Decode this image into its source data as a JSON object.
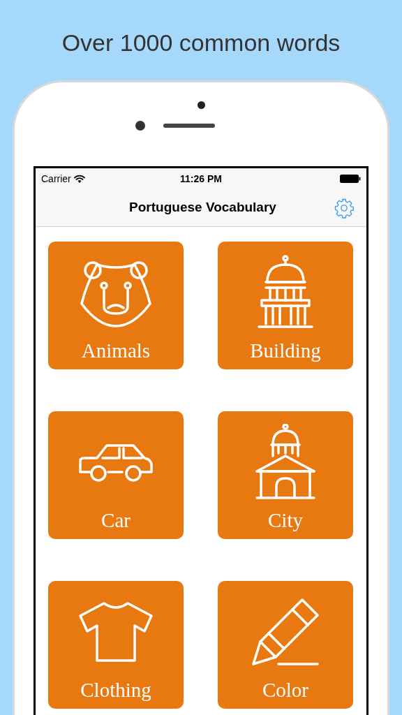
{
  "headline": "Over 1000 common words",
  "status_bar": {
    "carrier": "Carrier",
    "time": "11:26 PM"
  },
  "nav_bar": {
    "title": "Portuguese Vocabulary"
  },
  "categories": [
    {
      "label": "Animals"
    },
    {
      "label": "Building"
    },
    {
      "label": "Car"
    },
    {
      "label": "City"
    },
    {
      "label": "Clothing"
    },
    {
      "label": "Color"
    }
  ]
}
